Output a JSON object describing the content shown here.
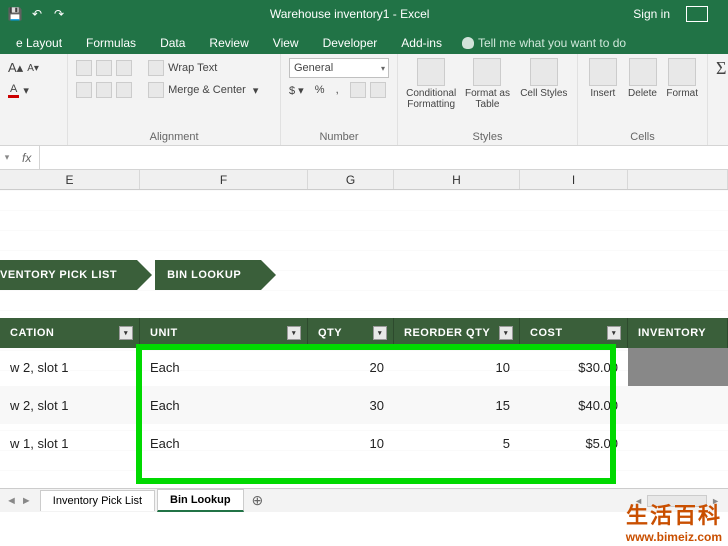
{
  "titlebar": {
    "title": "Warehouse inventory1  -  Excel",
    "signin": "Sign in"
  },
  "tabs": {
    "layout": "e Layout",
    "formulas": "Formulas",
    "data": "Data",
    "review": "Review",
    "view": "View",
    "developer": "Developer",
    "addins": "Add-ins",
    "tellme": "Tell me what you want to do"
  },
  "ribbon": {
    "wrap": "Wrap Text",
    "merge": "Merge & Center",
    "alignment": "Alignment",
    "numfmt": "General",
    "number": "Number",
    "cond": "Conditional Formatting",
    "fmt_table": "Format as Table",
    "cell_styles": "Cell Styles",
    "styles": "Styles",
    "insert": "Insert",
    "delete": "Delete",
    "format": "Format",
    "cells": "Cells"
  },
  "formula": {
    "fx": "fx"
  },
  "cols": {
    "E": "E",
    "F": "F",
    "G": "G",
    "H": "H",
    "I": "I"
  },
  "banners": {
    "pick": "VENTORY PICK LIST",
    "bin": "BIN LOOKUP"
  },
  "thead": {
    "location": "CATION",
    "unit": "UNIT",
    "qty": "QTY",
    "reorder": "REORDER QTY",
    "cost": "COST",
    "inventory": "INVENTORY"
  },
  "rows": [
    {
      "loc": "w 2, slot 1",
      "unit": "Each",
      "qty": "20",
      "reorder": "10",
      "cost": "$30.00"
    },
    {
      "loc": "w 2, slot 1",
      "unit": "Each",
      "qty": "30",
      "reorder": "15",
      "cost": "$40.00"
    },
    {
      "loc": "w 1, slot 1",
      "unit": "Each",
      "qty": "10",
      "reorder": "5",
      "cost": "$5.00"
    }
  ],
  "sheets": {
    "pick": "Inventory Pick List",
    "bin": "Bin Lookup"
  },
  "watermark": {
    "cn": "生活百科",
    "url": "www.bimeiz.com"
  },
  "col_widths": {
    "rowhd": 0,
    "E": 140,
    "F": 168,
    "G": 86,
    "H": 126,
    "I": 108,
    "J": 100
  }
}
